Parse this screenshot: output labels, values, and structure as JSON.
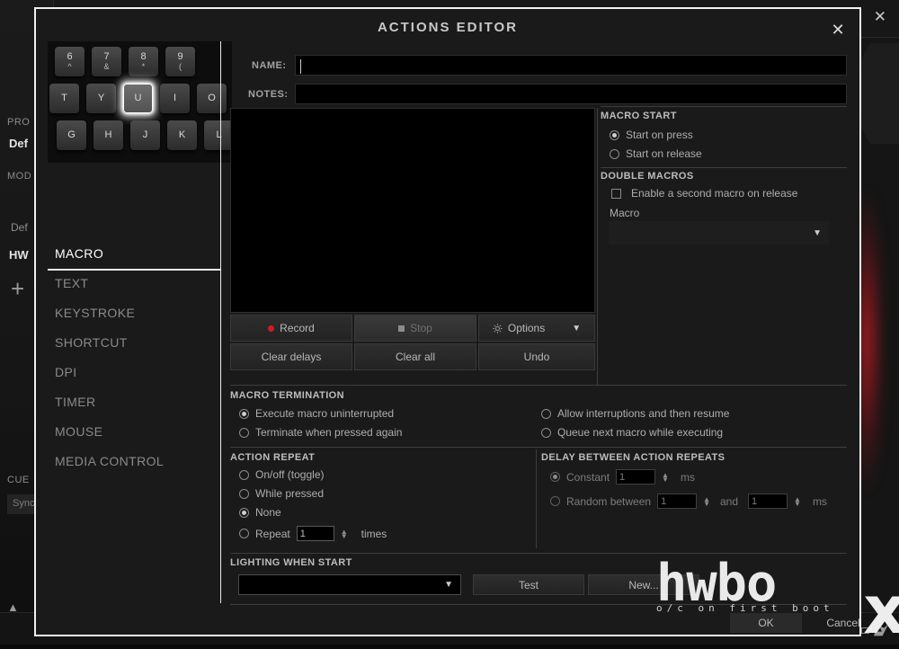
{
  "background": {
    "tab_label": "PR",
    "profile_label": "PRO",
    "profile_value": "Def",
    "mode_label": "MOD",
    "mode_default": "Def",
    "mode_hw": "HW",
    "add_icon": "+",
    "cue_label": "CUE",
    "sync_label": "Sync",
    "close_icon": "✕",
    "collapse_icon": "▲"
  },
  "dialog": {
    "title": "ACTIONS EDITOR",
    "close_icon": "✕",
    "name_label": "NAME:",
    "name_value": "",
    "notes_label": "NOTES:",
    "notes_value": ""
  },
  "keyboard": {
    "rows": [
      [
        {
          "main": "6",
          "sub": "^"
        },
        {
          "main": "7",
          "sub": "&"
        },
        {
          "main": "8",
          "sub": "*"
        },
        {
          "main": "9",
          "sub": "("
        }
      ],
      [
        {
          "main": "T",
          "sub": ""
        },
        {
          "main": "Y",
          "sub": ""
        },
        {
          "main": "U",
          "sub": "",
          "lit": true
        },
        {
          "main": "I",
          "sub": ""
        },
        {
          "main": "O",
          "sub": ""
        }
      ],
      [
        {
          "main": "G",
          "sub": ""
        },
        {
          "main": "H",
          "sub": ""
        },
        {
          "main": "J",
          "sub": ""
        },
        {
          "main": "K",
          "sub": ""
        },
        {
          "main": "L",
          "sub": ""
        }
      ]
    ]
  },
  "action_types": [
    {
      "label": "MACRO",
      "selected": true
    },
    {
      "label": "TEXT",
      "selected": false
    },
    {
      "label": "KEYSTROKE",
      "selected": false
    },
    {
      "label": "SHORTCUT",
      "selected": false
    },
    {
      "label": "DPI",
      "selected": false
    },
    {
      "label": "TIMER",
      "selected": false
    },
    {
      "label": "MOUSE",
      "selected": false
    },
    {
      "label": "MEDIA CONTROL",
      "selected": false
    }
  ],
  "record_controls": {
    "record_label": "Record",
    "stop_label": "Stop",
    "options_label": "Options",
    "options_caret": "▼",
    "clear_delays_label": "Clear delays",
    "clear_all_label": "Clear all",
    "undo_label": "Undo"
  },
  "macro_start": {
    "title": "MACRO START",
    "options": [
      {
        "label": "Start on press",
        "selected": true
      },
      {
        "label": "Start on release",
        "selected": false
      }
    ]
  },
  "double_macros": {
    "title": "DOUBLE MACROS",
    "checkbox_label": "Enable a second macro on release",
    "checked": false,
    "macro_label": "Macro",
    "macro_value": "",
    "caret": "▼"
  },
  "macro_termination": {
    "title": "MACRO TERMINATION",
    "options": [
      {
        "label": "Execute macro uninterrupted",
        "selected": true
      },
      {
        "label": "Terminate when pressed again",
        "selected": false
      },
      {
        "label": "Allow interruptions and then resume",
        "selected": false
      },
      {
        "label": "Queue next macro while executing",
        "selected": false
      }
    ]
  },
  "action_repeat": {
    "title": "ACTION REPEAT",
    "options": [
      {
        "label": "On/off (toggle)",
        "selected": false
      },
      {
        "label": "While pressed",
        "selected": false
      },
      {
        "label": "None",
        "selected": true
      },
      {
        "label": "Repeat",
        "selected": false
      }
    ],
    "repeat_value": "1",
    "times_label": "times"
  },
  "delay_repeats": {
    "title": "DELAY BETWEEN ACTION REPEATS",
    "constant_label": "Constant",
    "constant_selected": true,
    "constant_value": "1",
    "constant_unit": "ms",
    "random_label": "Random between",
    "random_selected": false,
    "random_min": "1",
    "and_label": "and",
    "random_max": "1",
    "random_unit": "ms"
  },
  "lighting": {
    "title": "LIGHTING WHEN START",
    "select_value": "",
    "caret": "▼",
    "test_label": "Test",
    "new_label": "New..."
  },
  "footer": {
    "ok_label": "OK",
    "cancel_label": "Cancel"
  },
  "watermark": {
    "main": "hwbo",
    "x": "x",
    "sub": "o/c on first boot"
  }
}
